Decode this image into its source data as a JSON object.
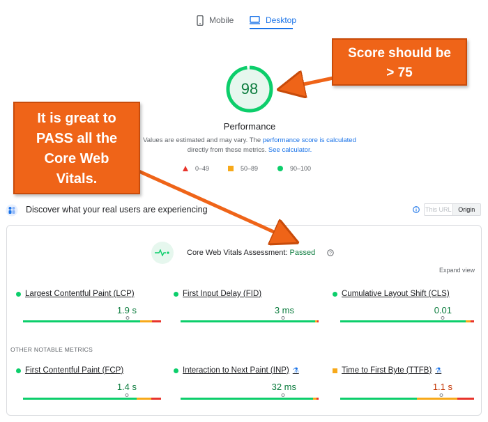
{
  "tabs": {
    "mobile": "Mobile",
    "desktop": "Desktop"
  },
  "performance": {
    "score": "98",
    "score_value": 98,
    "label": "Performance",
    "note_1": "Values are estimated and may vary. The ",
    "note_link_1": "performance score is calculated",
    "note_2": " directly from these metrics. ",
    "note_link_2": "See calculator."
  },
  "legend": {
    "low": "0–49",
    "mid": "50–89",
    "high": "90–100"
  },
  "field": {
    "title": "Discover what your real users are experiencing",
    "this_url": "This URL",
    "origin": "Origin"
  },
  "cwv": {
    "title": "Core Web Vitals Assessment: ",
    "status": "Passed",
    "expand": "Expand view",
    "other": "OTHER NOTABLE METRICS"
  },
  "metrics": {
    "lcp": {
      "name": "Largest Contentful Paint (LCP)",
      "value": "1.9 s"
    },
    "fid": {
      "name": "First Input Delay (FID)",
      "value": "3 ms"
    },
    "cls": {
      "name": "Cumulative Layout Shift (CLS)",
      "value": "0.01"
    },
    "fcp": {
      "name": "First Contentful Paint (FCP)",
      "value": "1.4 s"
    },
    "inp": {
      "name": "Interaction to Next Paint (INP)",
      "value": "32 ms"
    },
    "ttfb": {
      "name": "Time to First Byte (TTFB)",
      "value": "1.1 s"
    }
  },
  "callouts": {
    "score_line1": "Score should be",
    "score_line2": "> 75",
    "cwv_line1": "It is great to",
    "cwv_line2": "PASS all the",
    "cwv_line3": "Core Web",
    "cwv_line4": "Vitals."
  },
  "colors": {
    "good": "#0cce6b",
    "average": "#f7a91a",
    "poor": "#e8342b",
    "accent": "#1a73e8",
    "callout": "#ef6418"
  }
}
